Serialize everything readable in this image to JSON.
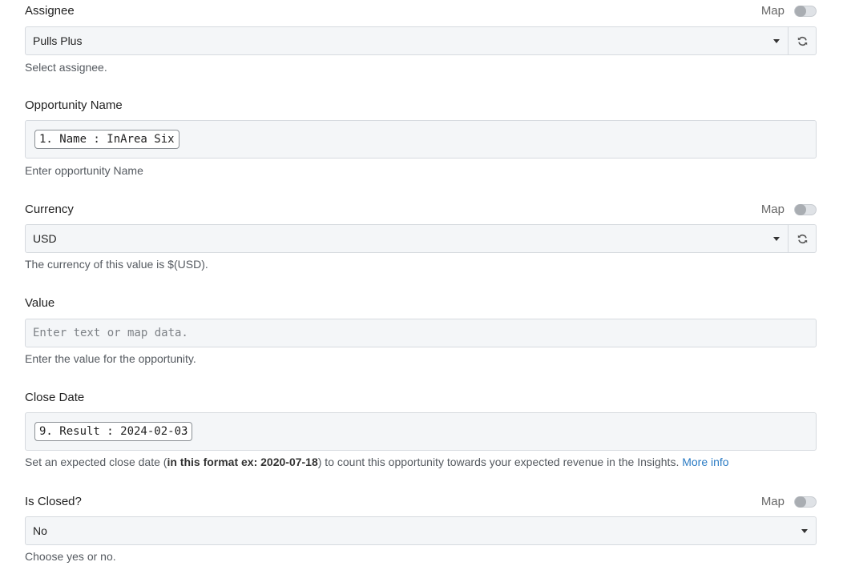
{
  "assignee": {
    "label": "Assignee",
    "map_label": "Map",
    "value": "Pulls Plus",
    "help": "Select assignee."
  },
  "opportunity_name": {
    "label": "Opportunity Name",
    "tag": "1. Name : InArea Six",
    "help": "Enter opportunity Name"
  },
  "currency": {
    "label": "Currency",
    "map_label": "Map",
    "value": "USD",
    "help": "The currency of this value is $(USD)."
  },
  "value_field": {
    "label": "Value",
    "placeholder": "Enter text or map data.",
    "help": "Enter the value for the opportunity."
  },
  "close_date": {
    "label": "Close Date",
    "tag": "9. Result : 2024-02-03",
    "help_prefix": "Set an expected close date (",
    "help_bold": "in this format ex: 2020-07-18",
    "help_suffix": ") to count this opportunity towards your expected revenue in the Insights.",
    "help_link": "More info"
  },
  "is_closed": {
    "label": "Is Closed?",
    "map_label": "Map",
    "value": "No",
    "help": "Choose yes or no."
  },
  "icons": {
    "refresh": "refresh-icon",
    "dropdown": "caret-down-icon"
  }
}
